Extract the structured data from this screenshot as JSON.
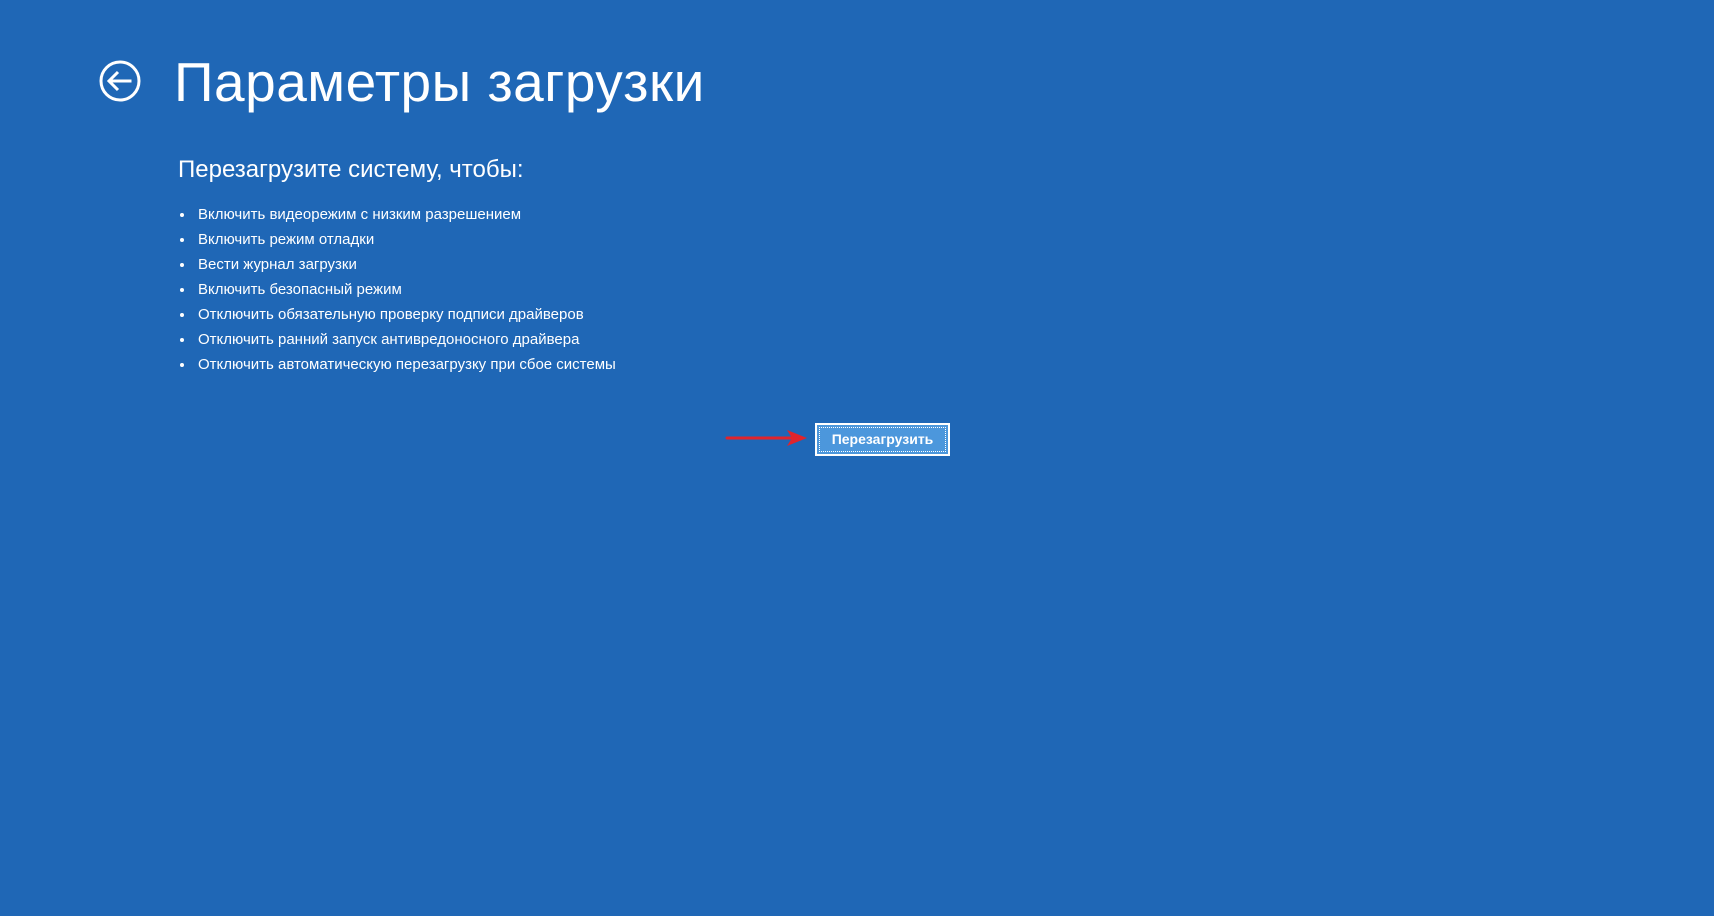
{
  "header": {
    "back_icon": "arrow-left-circle-icon",
    "title": "Параметры загрузки"
  },
  "main": {
    "subtitle": "Перезагрузите систему, чтобы:",
    "options": [
      "Включить видеорежим с низким разрешением",
      "Включить режим отладки",
      "Вести журнал загрузки",
      "Включить безопасный режим",
      "Отключить обязательную проверку подписи драйверов",
      "Отключить ранний запуск антивредоносного драйвера",
      "Отключить автоматическую перезагрузку при сбое системы"
    ],
    "restart_button": "Перезагрузить"
  },
  "annotation": {
    "arrow_icon": "red-arrow-right-icon",
    "arrow_color": "#e0242c"
  },
  "colors": {
    "background": "#1f67b6",
    "button_fill": "#4c97dc",
    "text": "#ffffff"
  }
}
